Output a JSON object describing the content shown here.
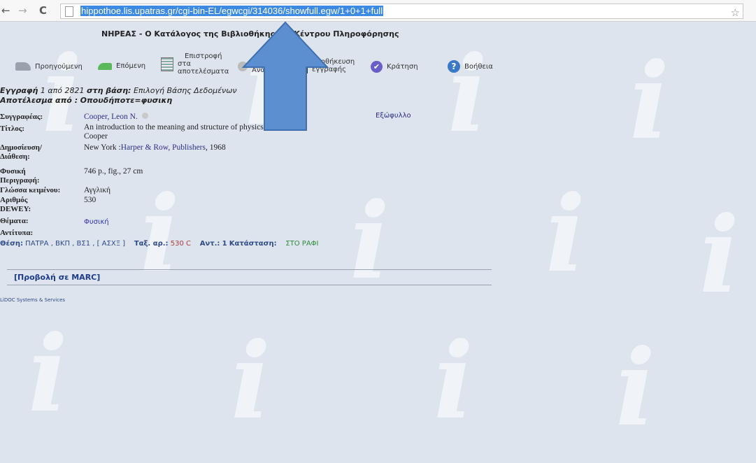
{
  "browser": {
    "back_icon": "back-arrow-icon",
    "forward_icon": "forward-arrow-icon",
    "reload_icon": "reload-icon",
    "url": "hippothoe.lis.upatras.gr/cgi-bin-EL/egwcgi/314036/showfull.egw/1+0+1+full"
  },
  "site": {
    "title": "ΝΗΡΕΑΣ - Ο Κατάλογος της Βιβλιοθήκης και Κέντρου Πληροφόρησης"
  },
  "toolbar": {
    "prev": "Προηγούμενη",
    "next": "Επόμενη",
    "return_l1": "Επιστροφή",
    "return_l2": "στα",
    "return_l3": "αποτελέσματα",
    "new_search": "Ανα",
    "save_l1": "Αποθήκευση",
    "save_l2": "εγγραφής",
    "reserve": "Κράτηση",
    "help": "Βοήθεια"
  },
  "record": {
    "line1_a": "Εγγραφή",
    "line1_b": "1 από",
    "line1_c": "2821",
    "line1_d": "στη βάση:",
    "line1_e": "Επιλογή Βάσης Δεδομένων",
    "line2_a": "Αποτέλεσμα από :",
    "line2_b": "Οπουδήποτε=φυσικη"
  },
  "fields": {
    "author_label": "Συγγραφέας:",
    "author": "Cooper, Leon N.",
    "cover": "Εξώφυλλο",
    "title_label": "Τίτλος:",
    "title_1": "An introduction to the meaning and structure of physics / Leon N.",
    "title_2": "Cooper",
    "pub_label_1": "Δημοσίευση/",
    "pub_label_2": "Διάθεση:",
    "pub_place": "New York :",
    "pub_name": "Harper & Row, Publishers",
    "pub_year": ", 1968",
    "phys_label_1": "Φυσική",
    "phys_label_2": "Περιγραφή:",
    "phys": "746 p., fig., 27 cm",
    "lang_label": "Γλώσσα κειμένου:",
    "lang": "Αγγλική",
    "dewey_label_1": "Αριθμός",
    "dewey_label_2": "DEWEY:",
    "dewey": "530",
    "subj_label": "Θέματα:",
    "subj": "Φυσική",
    "copies_label": "Αντίτυπα:"
  },
  "location": {
    "pos_label": "Θέση:",
    "pos": "ΠΑΤΡΑ , ΒΚΠ , ΒΣ1 , [ ΑΣΧΞ ]",
    "call_label": "Ταξ. αρ.:",
    "call": "530 C",
    "copy_label": "Αντ.:",
    "copy": "1",
    "status_label": "Κατάσταση:",
    "status": "ΣΤΟ ΡΑΦΙ"
  },
  "marc": "[Προβολή σε MARC]",
  "footer": "LiDOC Systems & Services",
  "colors": {
    "arrow": "#5b8fd0",
    "url_highlight": "#3d8ae4",
    "background": "#dde4ee"
  }
}
